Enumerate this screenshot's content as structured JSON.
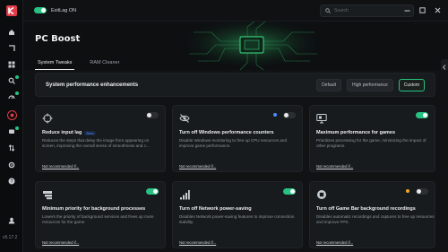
{
  "app": {
    "version": "v5.17.2",
    "colors": {
      "accent": "#27c281",
      "active_nav": "#e23c4a",
      "beta": "#4d8dff"
    }
  },
  "topbar": {
    "exitlag_label": "ExitLag ON",
    "exitlag_on": true,
    "search_placeholder": "Search"
  },
  "page": {
    "title": "PC Boost"
  },
  "tabs": [
    {
      "label": "System Tweaks",
      "active": true
    },
    {
      "label": "RAM Cleaner",
      "active": false
    }
  ],
  "system": {
    "label": "System performance enhancements",
    "modes": [
      {
        "label": "Default"
      },
      {
        "label": "High performance"
      },
      {
        "label": "Custom",
        "active": true
      }
    ]
  },
  "cards": [
    {
      "title": "Reduce input lag",
      "beta": "Beta",
      "desc": "Reduces the steps that delay the image from appearing on screen, improving the overall sense of smoothness and c...",
      "link": "Not recommended if...",
      "on": false,
      "icon": "crosshair-icon"
    },
    {
      "title": "Turn off Windows performance counters",
      "desc": "Disable Windows monitoring to free up CPU resources and improve game performance.",
      "link": "Not recommended if...",
      "on": false,
      "indicator": "#4d8dff",
      "icon": "eye-off-icon"
    },
    {
      "title": "Maximum performance for games",
      "desc": "Prioritizes processing for the game, minimizing the impact of other programs.",
      "link": "Not recommended if...",
      "on": true,
      "icon": "game-monitor-icon"
    },
    {
      "title": "Minimum priority for background processes",
      "desc": "Lowers the priority of background services and frees up more resources for the game.",
      "link": "Not recommended if...",
      "on": true,
      "icon": "layers-icon"
    },
    {
      "title": "Turn off Network power-saving",
      "desc": "Disables Network power-saving features to improve connection stability.",
      "link": "Not recommended if...",
      "on": true,
      "icon": "signal-bars-icon"
    },
    {
      "title": "Turn off Game Bar background recordings",
      "desc": "Disables automatic recordings and captures to free up resources and improve FPS.",
      "link": "Not recommended if...",
      "on": false,
      "indicator": "#f5a623",
      "icon": "record-icon"
    }
  ]
}
